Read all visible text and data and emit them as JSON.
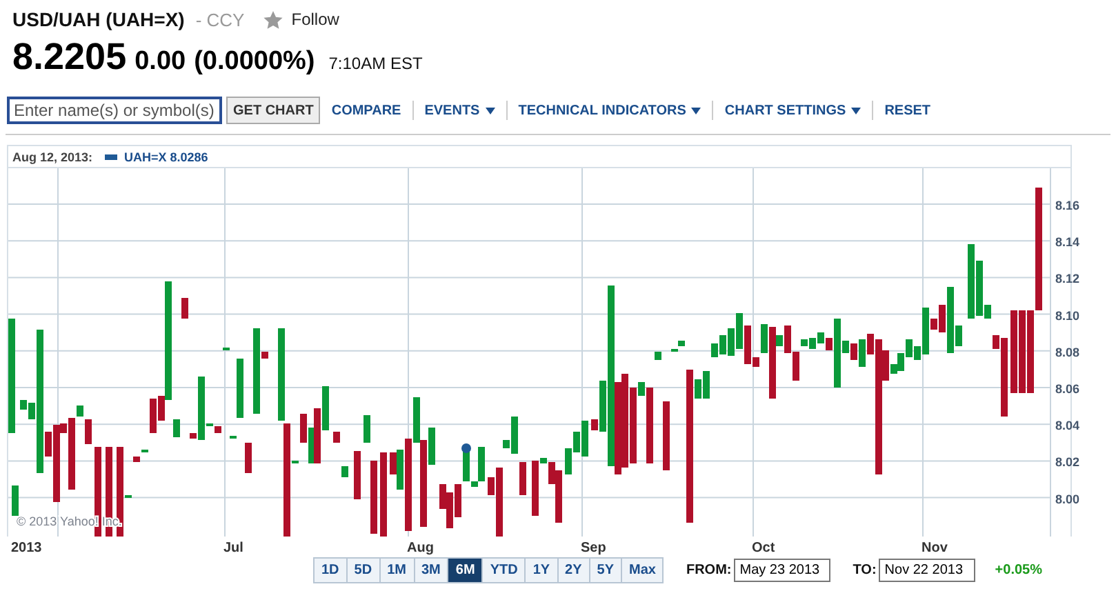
{
  "quote": {
    "title": "USD/UAH (UAH=X)",
    "exchange": "- CCY",
    "follow": "Follow",
    "price": "8.2205",
    "change": "0.00",
    "change_percent": "(0.0000%)",
    "time": "7:10AM EST"
  },
  "toolbar": {
    "search": {
      "placeholder": "Enter name(s) or symbol(s)"
    },
    "button": "GET CHART",
    "menus": [
      {
        "label": "COMPARE",
        "kind": "link"
      },
      {
        "label": "EVENTS",
        "kind": "dropdown"
      },
      {
        "label": "TECHNICAL INDICATORS",
        "kind": "dropdown"
      },
      {
        "label": "CHART SETTINGS",
        "kind": "dropdown"
      },
      {
        "label": "RESET",
        "kind": "link"
      }
    ]
  },
  "chart": {
    "date": "Aug 12, 2013:",
    "legend": {
      "label": "UAH=X 8.0286",
      "color": "#1f5a96"
    },
    "credit": "© 2013 Yahoo! Inc.",
    "y_ticks": [
      "8.16",
      "8.14",
      "8.12",
      "8.10",
      "8.08",
      "8.06",
      "8.04",
      "8.02",
      "8.00"
    ],
    "x_labels": [
      "2013",
      "Jul",
      "Aug",
      "Sep",
      "Oct",
      "Nov"
    ]
  },
  "ranges": [
    {
      "label": "1D",
      "selected": false
    },
    {
      "label": "5D",
      "selected": false
    },
    {
      "label": "1M",
      "selected": false
    },
    {
      "label": "3M",
      "selected": false
    },
    {
      "label": "6M",
      "selected": true
    },
    {
      "label": "YTD",
      "selected": false
    },
    {
      "label": "1Y",
      "selected": false
    },
    {
      "label": "2Y",
      "selected": false
    },
    {
      "label": "5Y",
      "selected": false
    },
    {
      "label": "Max",
      "selected": false
    }
  ],
  "from": {
    "label": "FROM:",
    "value": "May 23 2013"
  },
  "to": {
    "label": "TO:",
    "value": "Nov 22 2013"
  },
  "period_change": "+0.05%"
}
